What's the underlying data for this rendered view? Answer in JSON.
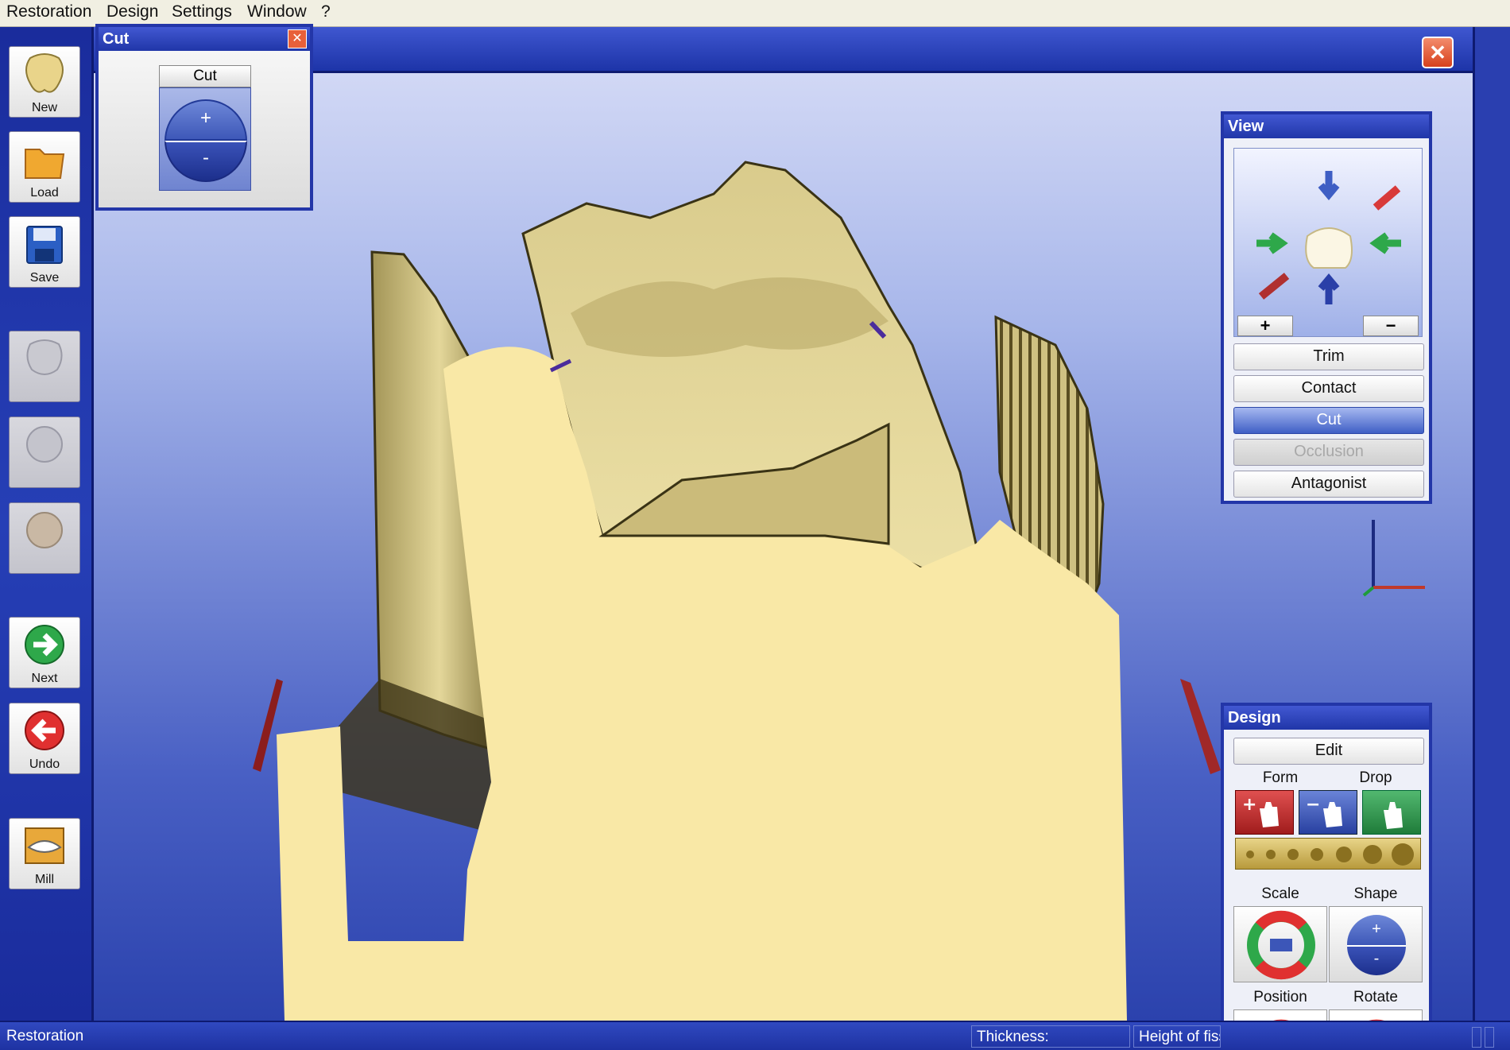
{
  "menu": {
    "items": [
      "Restoration",
      "Design",
      "Settings",
      "Window",
      "?"
    ]
  },
  "toolbar": {
    "new_label": "New",
    "load_label": "Load",
    "save_label": "Save",
    "next_label": "Next",
    "undo_label": "Undo",
    "mill_label": "Mill"
  },
  "cut_dialog": {
    "title": "Cut",
    "header_label": "Cut",
    "plus": "+",
    "minus": "-"
  },
  "view_panel": {
    "title": "View",
    "zoom_in": "+",
    "zoom_out": "−",
    "buttons": [
      "Trim",
      "Contact",
      "Cut",
      "Occlusion",
      "Antagonist"
    ],
    "active": "Cut",
    "disabled": "Occlusion"
  },
  "design_panel": {
    "title": "Design",
    "edit_label": "Edit",
    "form_label": "Form",
    "drop_label": "Drop",
    "scale_label": "Scale",
    "shape_label": "Shape",
    "position_label": "Position",
    "rotate_label": "Rotate",
    "shape_plus": "+",
    "shape_minus": "-"
  },
  "statusbar": {
    "mode": "Restoration",
    "thickness_label": "Thickness:",
    "height_label": "Height of fissure:"
  },
  "colors": {
    "frame_blue": "#2336a8",
    "tooth_base": "#f9e8a6",
    "tooth_surface": "#c7b574",
    "close_red": "#d7401c"
  },
  "icons": {
    "window_close": "close-icon",
    "view_widget": "tooth-view-icon",
    "axis": "axis-indicator-icon"
  }
}
